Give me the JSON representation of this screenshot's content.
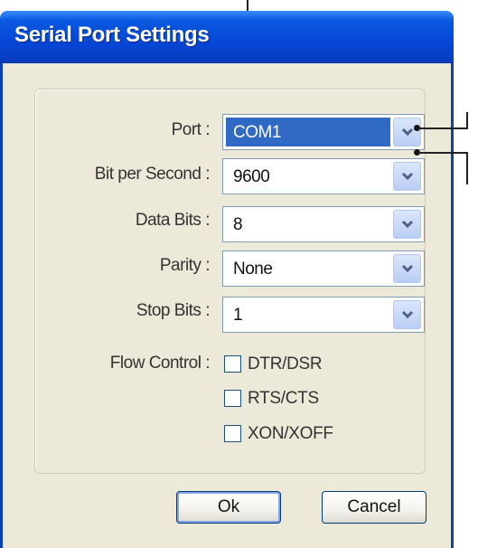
{
  "window": {
    "title": "Serial Port Settings"
  },
  "form": {
    "port": {
      "label": "Port :",
      "value": "COM1"
    },
    "bit_per_second": {
      "label": "Bit per Second :",
      "value": "9600"
    },
    "data_bits": {
      "label": "Data Bits :",
      "value": "8"
    },
    "parity": {
      "label": "Parity :",
      "value": "None"
    },
    "stop_bits": {
      "label": "Stop Bits :",
      "value": "1"
    },
    "flow_control": {
      "label": "Flow Control :",
      "options": [
        {
          "label": "DTR/DSR",
          "checked": false
        },
        {
          "label": "RTS/CTS",
          "checked": false
        },
        {
          "label": "XON/XOFF",
          "checked": false
        }
      ]
    }
  },
  "buttons": {
    "ok": "Ok",
    "cancel": "Cancel"
  },
  "colors": {
    "titlebar": "#0648d8",
    "selection": "#316ac5",
    "dialog_bg": "#ece9d8"
  }
}
